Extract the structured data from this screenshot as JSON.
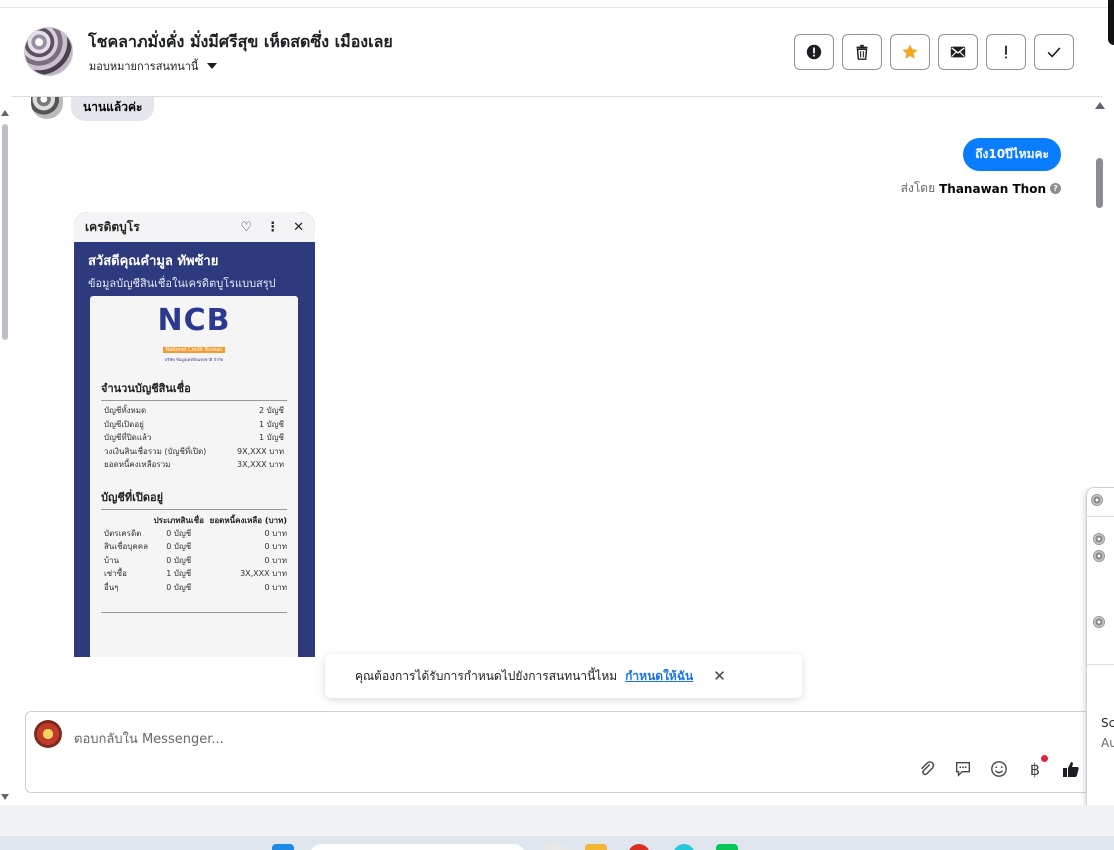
{
  "header": {
    "title": "โชคลาภมั่งคั่ง มั่งมีศรีสุข เห็ดสดซึ่ง เมืองเลย",
    "assign_label": "มอบหมายการสนทนานี้"
  },
  "actions": [
    {
      "name": "report-button",
      "icon": "alert-circle-icon"
    },
    {
      "name": "delete-button",
      "icon": "trash-icon"
    },
    {
      "name": "star-button",
      "icon": "star-icon",
      "color": "#f5a623"
    },
    {
      "name": "mark-unread-button",
      "icon": "envelope-icon"
    },
    {
      "name": "follow-up-button",
      "icon": "exclamation-icon"
    },
    {
      "name": "mark-done-button",
      "icon": "check-icon"
    }
  ],
  "messages": {
    "incoming_text": "นานแล้วค่ะ",
    "outgoing_text": "ถึง10ปีไหมคะ",
    "sent_by_prefix": "ส่งโดย",
    "sent_by_name": "Thanawan Thon",
    "help_glyph": "?"
  },
  "phone_screenshot": {
    "bar_title": "เครดิตบูโร",
    "greeting": "สวัสดีคุณคำมูล ทัพซ้าย",
    "subtitle": "ข้อมูลบัญชีสินเชื่อในเครดิตบูโรแบบสรุป",
    "logo_text": "NCB",
    "logo_band": "National Credit Bureau",
    "logo_sub": "บริษัท ข้อมูลเครดิตแห่งชาติ จำกัด",
    "section1_title": "จำนวนบัญชีสินเชื่อ",
    "summary": [
      {
        "label": "บัญชีทั้งหมด",
        "value": "2 บัญชี"
      },
      {
        "label": "บัญชีเปิดอยู่",
        "value": "1 บัญชี"
      },
      {
        "label": "บัญชีที่ปิดแล้ว",
        "value": "1 บัญชี"
      },
      {
        "label": "วงเงินสินเชื่อรวม (บัญชีที่เปิด)",
        "value": "9X,XXX บาท"
      },
      {
        "label": "ยอดหนี้คงเหลือรวม",
        "value": "3X,XXX บาท"
      }
    ],
    "section2_title": "บัญชีที่เปิดอยู่",
    "table_headers": [
      "",
      "ประเภทสินเชื่อ",
      "ยอดหนี้คงเหลือ (บาท)"
    ],
    "table_rows": [
      {
        "type": "บัตรเครดิต",
        "count": "0 บัญชี",
        "amount": "0 บาท"
      },
      {
        "type": "สินเชื่อบุคคล",
        "count": "0 บัญชี",
        "amount": "0 บาท"
      },
      {
        "type": "บ้าน",
        "count": "0 บัญชี",
        "amount": "0 บาท"
      },
      {
        "type": "เช่าซื้อ",
        "count": "1 บัญชี",
        "amount": "3X,XXX บาท"
      },
      {
        "type": "อื่นๆ",
        "count": "0 บัญชี",
        "amount": "0 บาท"
      }
    ]
  },
  "toast": {
    "question": "คุณต้องการได้รับการกำหนดไปยังการสนทนานี้ไหม",
    "link": "กำหนดให้ฉัน",
    "close": "✕"
  },
  "composer": {
    "placeholder": "ตอบกลับใน Messenger...",
    "tools": [
      "paperclip-icon",
      "speech-bubble-icon",
      "emoji-icon",
      "baht-icon",
      "thumbs-up-icon"
    ]
  },
  "side_panel": {
    "text_1": "Sc",
    "text_2": "Au"
  }
}
